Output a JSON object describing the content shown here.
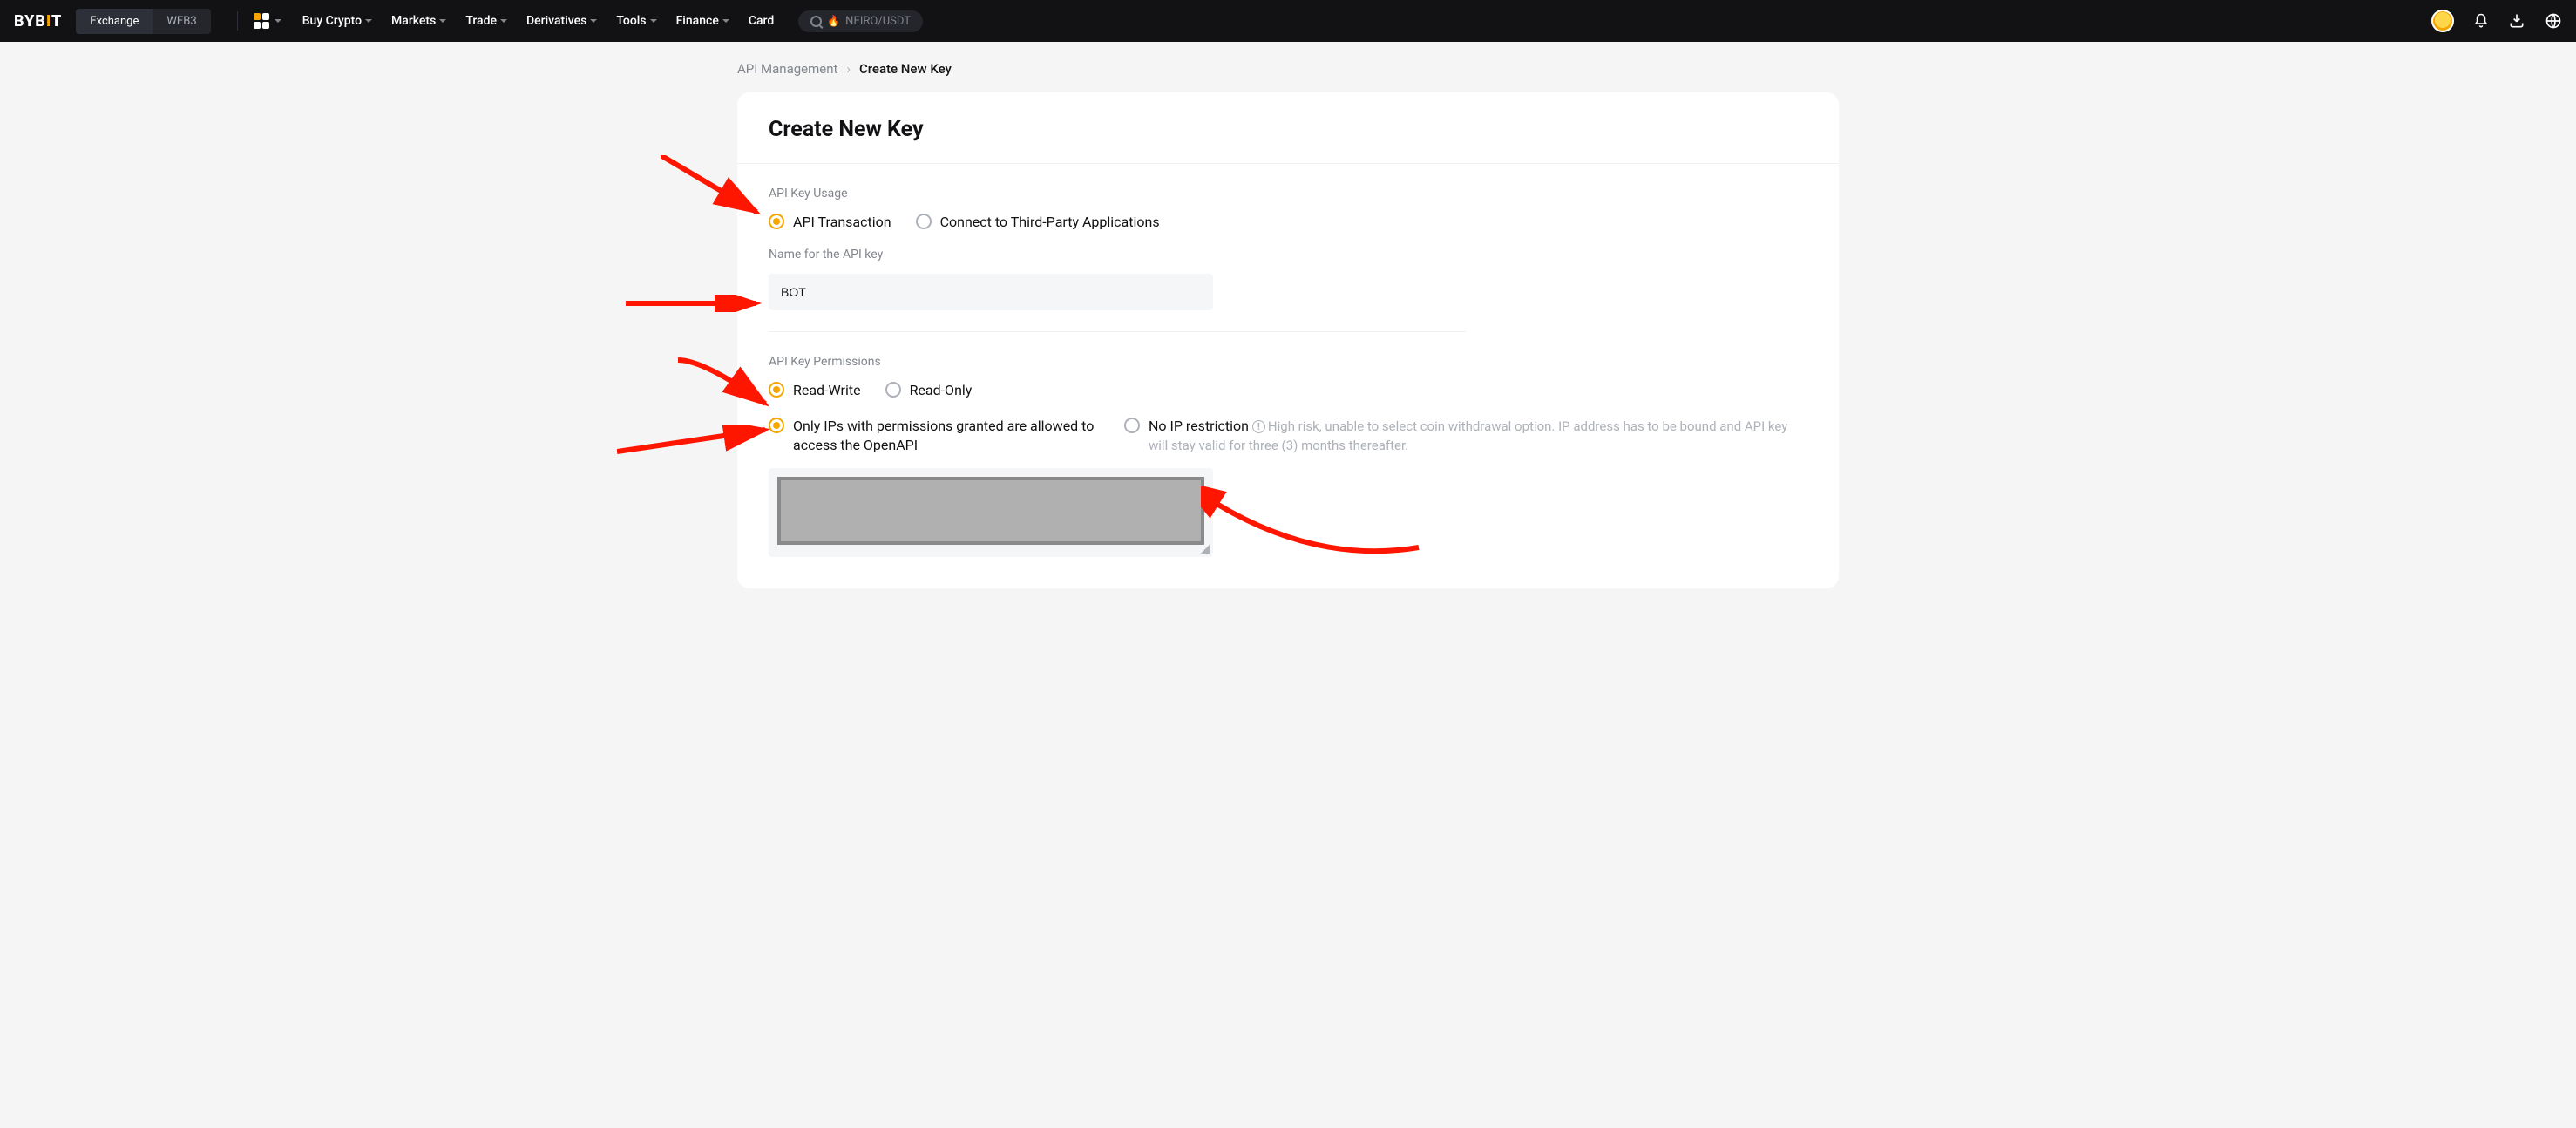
{
  "header": {
    "logo_pre": "BYB",
    "logo_i": "I",
    "logo_post": "T",
    "tabs": {
      "exchange": "Exchange",
      "web3": "WEB3"
    },
    "nav": {
      "buy_crypto": "Buy Crypto",
      "markets": "Markets",
      "trade": "Trade",
      "derivatives": "Derivatives",
      "tools": "Tools",
      "finance": "Finance",
      "card": "Card"
    },
    "search_prefix": "🔥",
    "search_text": "NEIRO/USDT"
  },
  "breadcrumb": {
    "prev": "API Management",
    "current": "Create New Key"
  },
  "page": {
    "title": "Create New Key",
    "usage_label": "API Key Usage",
    "usage_opt1": "API Transaction",
    "usage_opt2": "Connect to Third-Party Applications",
    "name_label": "Name for the API key",
    "name_value": "BOT",
    "perm_label": "API Key Permissions",
    "perm_opt1": "Read-Write",
    "perm_opt2": "Read-Only",
    "ip_opt1": "Only IPs with permissions granted are allowed to access the OpenAPI",
    "ip_opt2": "No IP restriction",
    "ip_hint": "High risk, unable to select coin withdrawal option. IP address has to be bound and API key will stay valid for three (3) months thereafter."
  }
}
